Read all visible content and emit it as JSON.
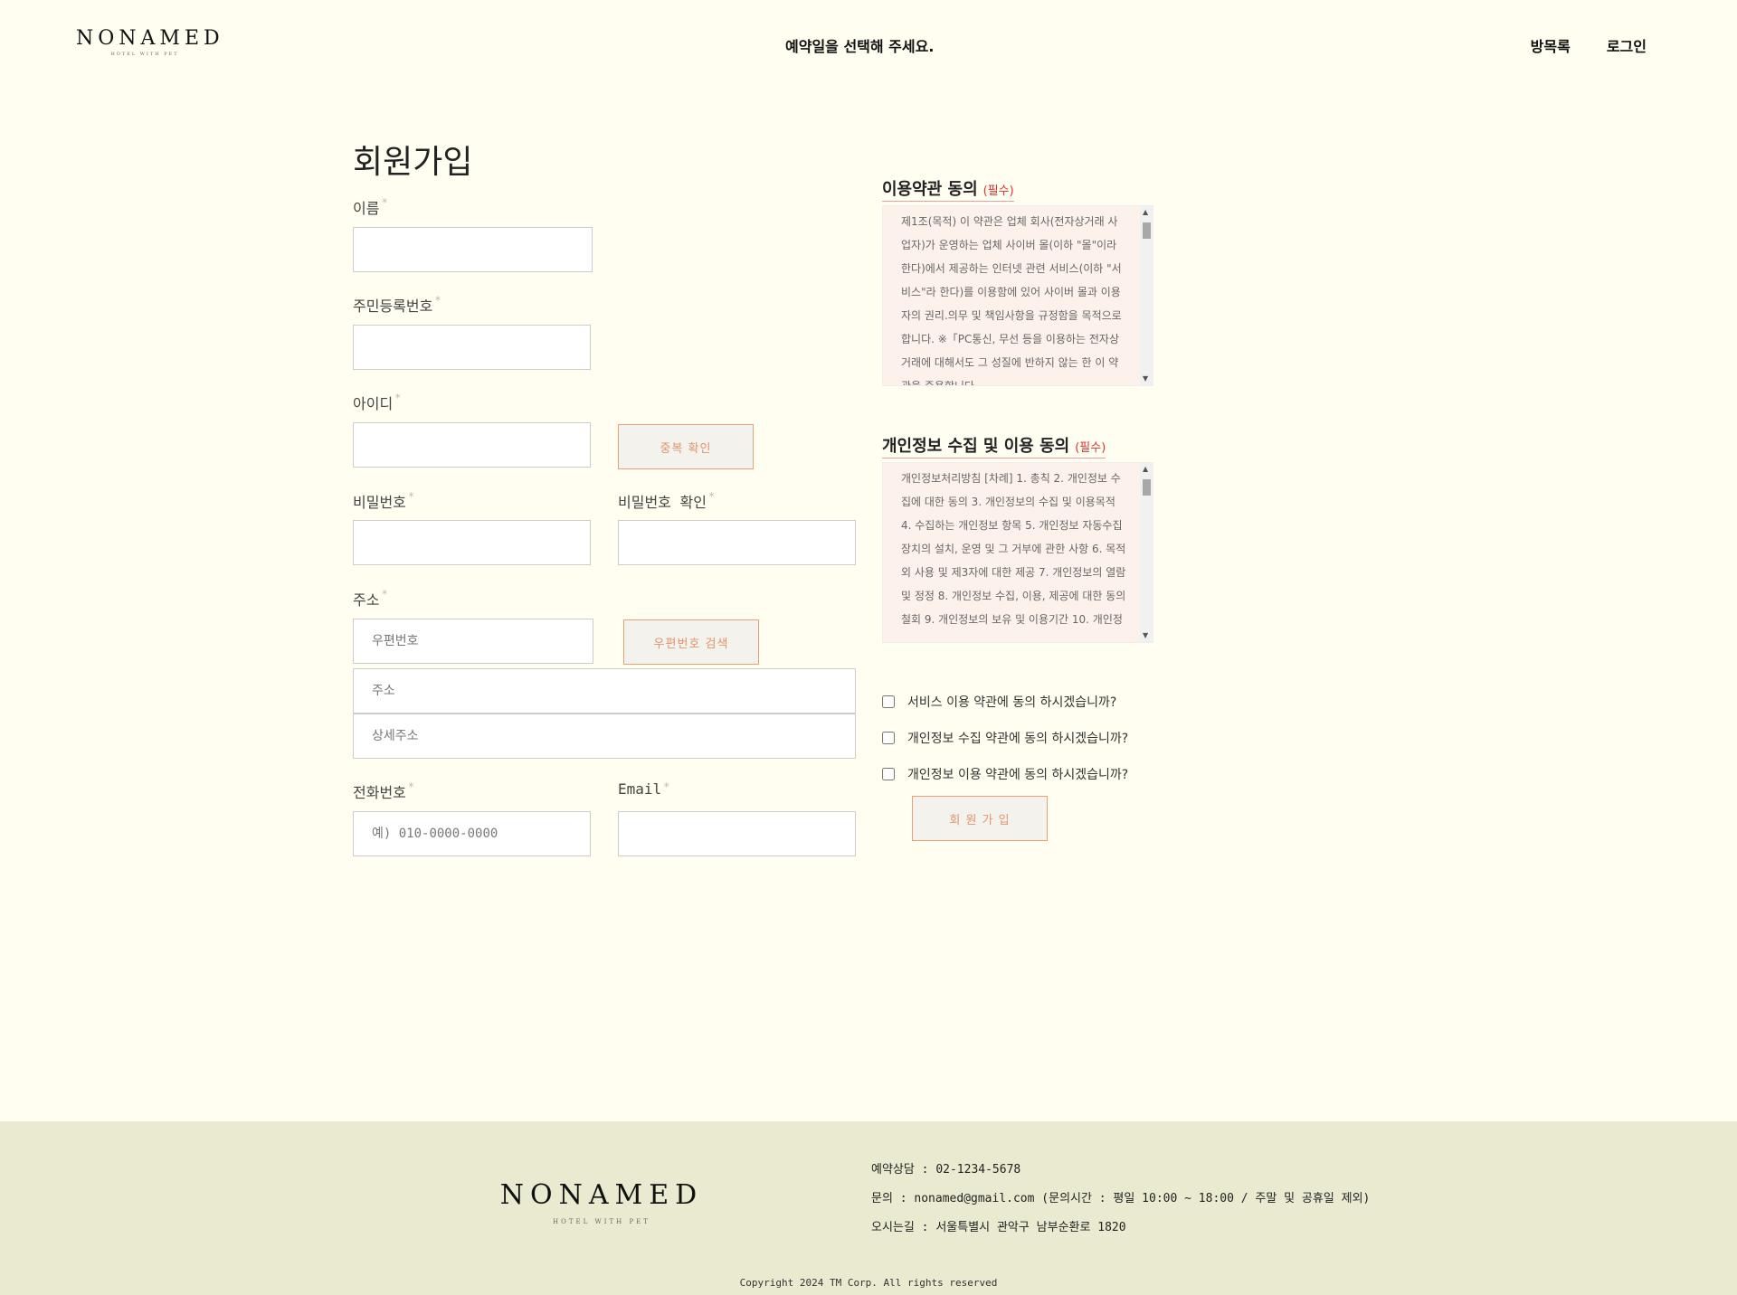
{
  "header": {
    "logo": "NONAMED",
    "logo_sub": "HOTEL WITH PET",
    "center_text": "예약일을 선택해 주세요.",
    "nav": [
      "방목록",
      "로그인"
    ]
  },
  "form": {
    "title": "회원가입",
    "required_mark": "*",
    "name_label": "이름",
    "rrn_label": "주민등록번호",
    "id_label": "아이디",
    "dup_check_button": "중복 확인",
    "password_label": "비밀번호",
    "password_confirm_label": "비밀번호 확인",
    "address_label": "주소",
    "zipcode_placeholder": "우편번호",
    "zipcode_search_button": "우편번호 검색",
    "address_placeholder": "주소",
    "address_detail_placeholder": "상세주소",
    "phone_label": "전화번호",
    "phone_placeholder": "예) 010-0000-0000",
    "email_label": "Email"
  },
  "terms": {
    "service_title": "이용약관 동의",
    "required_tag": "(필수)",
    "service_text": "제1조(목적) 이 약관은 업체 회사(전자상거래 사업자)가 운영하는 업체 사이버 몰(이하 \"몰\"이라 한다)에서 제공하는 인터넷 관련 서비스(이하 \"서비스\"라 한다)를 이용함에 있어 사이버 몰과 이용자의 권리.의무 및 책임사항을 규정함을 목적으로 합니다. ※「PC통신, 무선 등을 이용하는 전자상거래에 대해서도 그 성질에 반하지 않는 한 이 약관을 준용합니다",
    "privacy_title": "개인정보 수집 및 이용 동의",
    "privacy_text": "개인정보처리방침 [차례] 1. 총칙 2. 개인정보 수집에 대한 동의 3. 개인정보의 수집 및 이용목적 4. 수집하는 개인정보 항목 5. 개인정보 자동수집 장치의 설치, 운영 및 그 거부에 관한 사항 6. 목적 외 사용 및 제3자에 대한 제공 7. 개인정보의 열람 및 정정 8. 개인정보 수집, 이용, 제공에 대한 동의철회 9. 개인정보의 보유 및 이용기간 10. 개인정",
    "checks": [
      "서비스 이용 약관에 동의 하시겠습니까?",
      "개인정보 수집 약관에 동의 하시겠습니까?",
      "개인정보 이용 약관에 동의 하시겠습니까?"
    ],
    "submit_button": "회 원 가 입"
  },
  "footer": {
    "logo": "NONAMED",
    "logo_sub": "HOTEL WITH PET",
    "reservation": "예약상담 : 02-1234-5678",
    "inquiry": "문의 : nonamed@gmail.com (문의시간 : 평일 10:00 ~ 18:00 / 주말 및 공휴일 제외)",
    "location": "오시는길 : 서울특별시 관악구 남부순환로 1820",
    "copyright": "Copyright 2024 TM Corp. All rights reserved"
  }
}
